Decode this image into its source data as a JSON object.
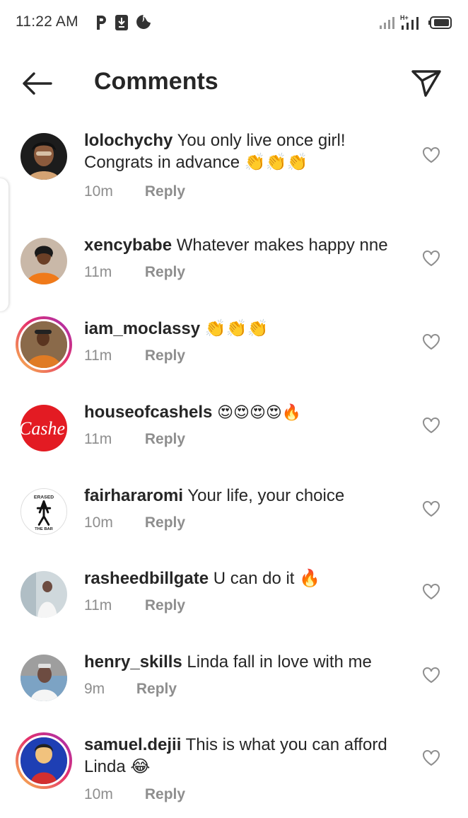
{
  "status_bar": {
    "time": "11:22 AM",
    "left_icons": [
      "parking-icon",
      "download-icon",
      "hand-icon"
    ],
    "right_icons": [
      "signal-icon",
      "signal-h-plus-icon",
      "battery-icon"
    ]
  },
  "header": {
    "title": "Comments",
    "back_icon": "arrow-left-icon",
    "share_icon": "send-icon"
  },
  "reply_label": "Reply",
  "comments": [
    {
      "username": "lolochychy",
      "text": "You only live once girl! Congrats in advance 👏👏👏",
      "time": "10m",
      "avatar_ring": false
    },
    {
      "username": "xencybabe",
      "text": "Whatever makes happy nne",
      "time": "11m",
      "avatar_ring": false
    },
    {
      "username": "iam_moclassy",
      "text": "👏👏👏",
      "time": "11m",
      "avatar_ring": true
    },
    {
      "username": "houseofcashels",
      "text": "😍😍😍😍🔥",
      "time": "11m",
      "avatar_ring": false,
      "avatar_text": "Cashe"
    },
    {
      "username": "fairhararomi",
      "text": "Your life, your choice",
      "time": "10m",
      "avatar_ring": false,
      "avatar_text_top": "ERASED",
      "avatar_text_bottom": "THE BAR"
    },
    {
      "username": "rasheedbillgate",
      "text": "U can do it 🔥",
      "time": "11m",
      "avatar_ring": false
    },
    {
      "username": "henry_skills",
      "text": "Linda fall in love with me",
      "time": "9m",
      "avatar_ring": false
    },
    {
      "username": "samuel.dejii",
      "text": "This is what you can afford Linda 😂",
      "time": "10m",
      "avatar_ring": true
    }
  ],
  "colors": {
    "text": "#262626",
    "secondary": "#8e8e8e",
    "story_ring_start": "#f9c24c",
    "story_ring_end": "#a12fb6",
    "cashels_red": "#e31b23"
  }
}
